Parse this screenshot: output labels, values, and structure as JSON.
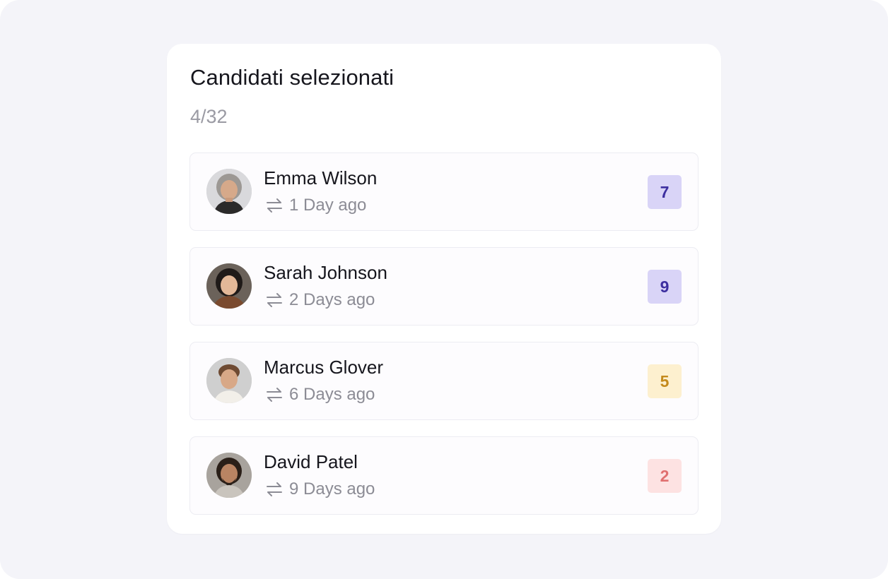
{
  "card": {
    "title": "Candidati selezionati",
    "count": "4/32"
  },
  "candidates": [
    {
      "name": "Emma Wilson",
      "time": "1 Day ago",
      "score": "7",
      "badge_bg": "#d9d4f7",
      "badge_fg": "#3d2fa0"
    },
    {
      "name": "Sarah Johnson",
      "time": "2 Days ago",
      "score": "9",
      "badge_bg": "#d9d4f7",
      "badge_fg": "#3d2fa0"
    },
    {
      "name": "Marcus Glover",
      "time": "6 Days ago",
      "score": "5",
      "badge_bg": "#fdf0cf",
      "badge_fg": "#c48a1c"
    },
    {
      "name": "David Patel",
      "time": "9 Days ago",
      "score": "2",
      "badge_bg": "#fde2e2",
      "badge_fg": "#e07070"
    }
  ],
  "icons": {
    "meta_icon": "swap-arrows-icon"
  }
}
